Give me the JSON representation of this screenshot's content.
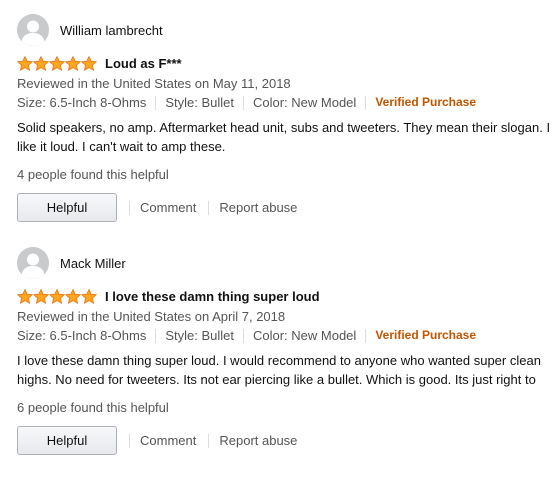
{
  "colors": {
    "star": "#ffa41c",
    "verified": "#c45500",
    "meta_text": "#555555",
    "body_text": "#111111"
  },
  "reviews": [
    {
      "author": "William lambrecht",
      "avatar_icon": "user-avatar-icon",
      "rating": 5,
      "title": "Loud as F***",
      "date": "Reviewed in the United States on May 11, 2018",
      "size": "Size: 6.5-Inch 8-Ohms",
      "style": "Style: Bullet",
      "color": "Color: New Model",
      "verified": "Verified Purchase",
      "body_line1": "Solid speakers, no amp. Aftermarket head unit, subs and tweeters. They mean their slogan. I",
      "body_line2": "like it loud. I can't wait to amp these.",
      "helpful_count": "4 people found this helpful",
      "helpful_button": "Helpful",
      "comment_link": "Comment",
      "report_link": "Report abuse"
    },
    {
      "author": "Mack Miller",
      "avatar_icon": "user-avatar-icon",
      "rating": 5,
      "title": "I love these damn thing super loud",
      "date": "Reviewed in the United States on April 7, 2018",
      "size": "Size: 6.5-Inch 8-Ohms",
      "style": "Style: Bullet",
      "color": "Color: New Model",
      "verified": "Verified Purchase",
      "body_line1": "I love these damn thing super loud. I would recommend to anyone who wanted super clean",
      "body_line2": "highs. No need for tweeters. Its not ear piercing like a bullet. Which is good. Its just right to",
      "helpful_count": "6 people found this helpful",
      "helpful_button": "Helpful",
      "comment_link": "Comment",
      "report_link": "Report abuse"
    }
  ]
}
